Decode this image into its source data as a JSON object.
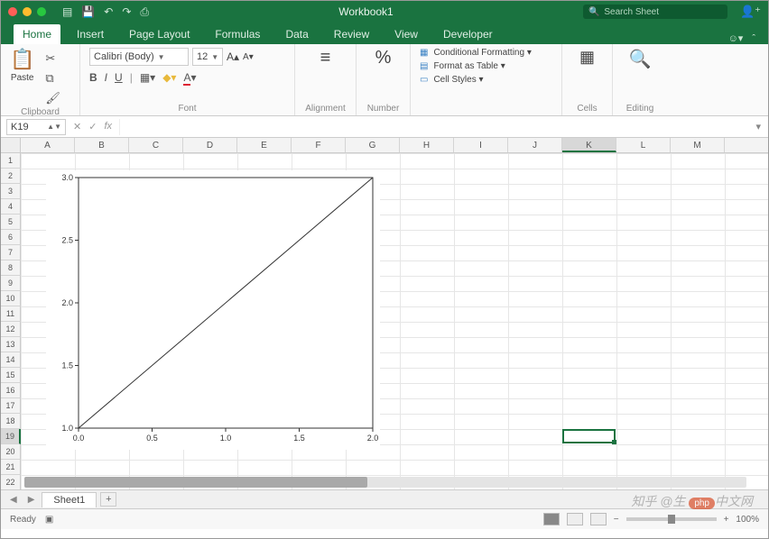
{
  "window": {
    "title": "Workbook1",
    "search_placeholder": "Search Sheet"
  },
  "tabs": {
    "items": [
      "Home",
      "Insert",
      "Page Layout",
      "Formulas",
      "Data",
      "Review",
      "View",
      "Developer"
    ],
    "active": "Home"
  },
  "ribbon": {
    "clipboard": {
      "paste": "Paste",
      "label": "Clipboard"
    },
    "font": {
      "name": "Calibri (Body)",
      "size": "12",
      "label": "Font",
      "bold": "B",
      "italic": "I",
      "underline": "U"
    },
    "alignment": {
      "label": "Alignment"
    },
    "number": {
      "label": "Number",
      "percent": "%"
    },
    "styles": {
      "cond": "Conditional Formatting",
      "table": "Format as Table",
      "cell": "Cell Styles"
    },
    "cells": {
      "label": "Cells"
    },
    "editing": {
      "label": "Editing"
    }
  },
  "formula": {
    "namebox": "K19",
    "fx": "fx"
  },
  "grid": {
    "cols": [
      "A",
      "B",
      "C",
      "D",
      "E",
      "F",
      "G",
      "H",
      "I",
      "J",
      "K",
      "L",
      "M"
    ],
    "rows": 22,
    "sel": {
      "col": "K",
      "row": 19
    }
  },
  "chart_data": {
    "type": "line",
    "x": [
      0.0,
      2.0
    ],
    "y": [
      1.0,
      3.0
    ],
    "xticks": [
      0.0,
      0.5,
      1.0,
      1.5,
      2.0
    ],
    "yticks": [
      1.0,
      1.5,
      2.0,
      2.5,
      3.0
    ],
    "xlim": [
      0.0,
      2.0
    ],
    "ylim": [
      1.0,
      3.0
    ],
    "title": "",
    "xlabel": "",
    "ylabel": ""
  },
  "sheets": {
    "active": "Sheet1"
  },
  "status": {
    "ready": "Ready",
    "zoom": "100%"
  },
  "watermark": {
    "zhihu": "知乎 @生",
    "php": "php",
    "cn": "中文网"
  }
}
